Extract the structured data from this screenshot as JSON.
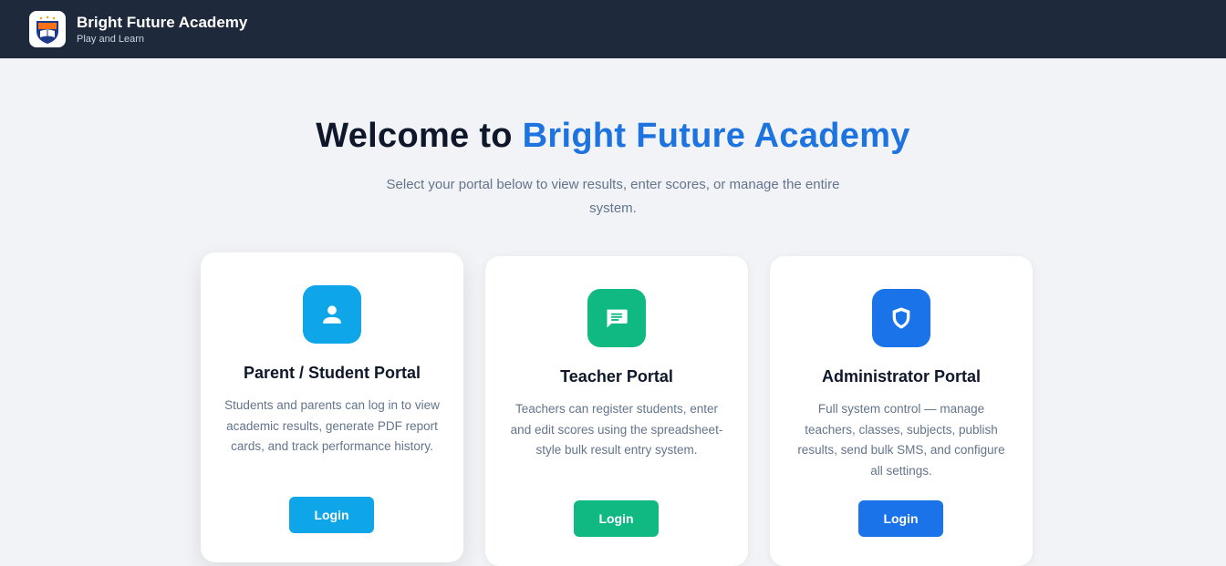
{
  "header": {
    "school_name": "Bright Future Academy",
    "tagline": "Play and Learn"
  },
  "hero": {
    "title_prefix": "Welcome to ",
    "title_accent": "Bright Future Academy",
    "subtitle": "Select your portal below to view results, enter scores, or manage the entire system."
  },
  "portals": [
    {
      "title": "Parent / Student Portal",
      "description": "Students and parents can log in to view academic results, generate PDF report cards, and track performance history.",
      "button_label": "Login",
      "color": "#0ea5e9",
      "icon": "user-icon"
    },
    {
      "title": "Teacher Portal",
      "description": "Teachers can register students, enter and edit scores using the spreadsheet-style bulk result entry system.",
      "button_label": "Login",
      "color": "#10b981",
      "icon": "message-icon"
    },
    {
      "title": "Administrator Portal",
      "description": "Full system control — manage teachers, classes, subjects, publish results, send bulk SMS, and configure all settings.",
      "button_label": "Login",
      "color": "#1a73e8",
      "icon": "shield-icon"
    }
  ],
  "colors": {
    "header_bg": "#1e293b",
    "page_bg": "#f1f3f6",
    "accent": "#1d74e0"
  }
}
